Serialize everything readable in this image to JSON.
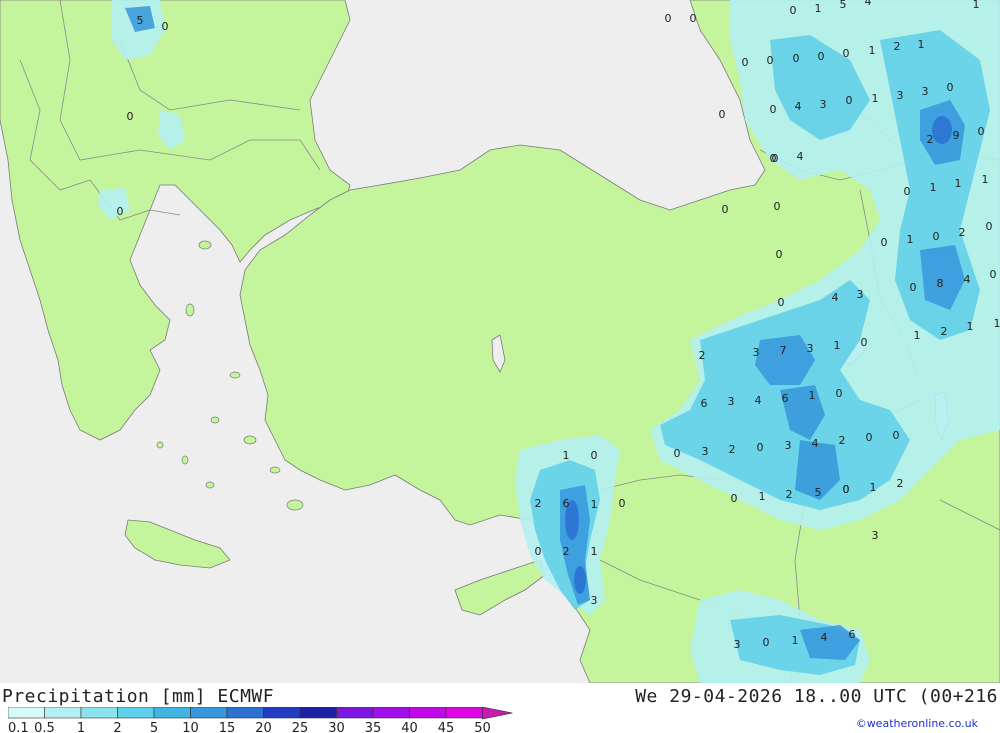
{
  "header": {
    "title": "Precipitation [mm] ECMWF",
    "valid_time": "We 29-04-2026 18..00 UTC (00+216",
    "credit": "©weatheronline.co.uk"
  },
  "colors": {
    "sea": "#eeeeee",
    "land": "#c4f59c",
    "border": "#8a8a8a"
  },
  "legend": {
    "labels": [
      "0.1",
      "0.5",
      "1",
      "2",
      "5",
      "10",
      "15",
      "20",
      "25",
      "30",
      "35",
      "40",
      "45",
      "50"
    ],
    "colors": [
      "#d6faf8",
      "#b4f0f2",
      "#8ae3ee",
      "#5ecfe8",
      "#40b4e2",
      "#3697dc",
      "#2c72d2",
      "#243cc2",
      "#1d21a4",
      "#7d16e0",
      "#a10ee8",
      "#c108e6",
      "#de06e2",
      "#c81ab0"
    ]
  },
  "map_values": {
    "nw_balkans": [
      "5",
      "0",
      "0",
      "0"
    ],
    "black_sea_east": [
      "0",
      "0",
      "0",
      "0",
      "0",
      "0",
      "0",
      "0"
    ],
    "caucasus": [
      "0",
      "1",
      "5",
      "4",
      "1",
      "0",
      "0",
      "0",
      "0",
      "0",
      "1",
      "2",
      "1",
      "0",
      "4",
      "3",
      "0",
      "1",
      "3",
      "3",
      "0",
      "0",
      "4",
      "2",
      "9",
      "0",
      "0",
      "1",
      "1",
      "1",
      "0",
      "1",
      "0",
      "2",
      "0",
      "0",
      "8",
      "4",
      "0",
      "1",
      "2",
      "1",
      "1"
    ],
    "east_anatolia": [
      "4",
      "3",
      "2",
      "3",
      "7",
      "3",
      "1",
      "0",
      "6",
      "3",
      "4",
      "6",
      "1",
      "0",
      "0",
      "3",
      "2",
      "0",
      "3",
      "4",
      "2",
      "0",
      "0",
      "0",
      "1",
      "0",
      "2",
      "5",
      "0",
      "1",
      "2",
      "3"
    ],
    "levant": [
      "1",
      "0",
      "2",
      "6",
      "1",
      "0",
      "0",
      "2",
      "1",
      "3"
    ],
    "iraq_south": [
      "3",
      "0",
      "1",
      "4",
      "6"
    ]
  }
}
